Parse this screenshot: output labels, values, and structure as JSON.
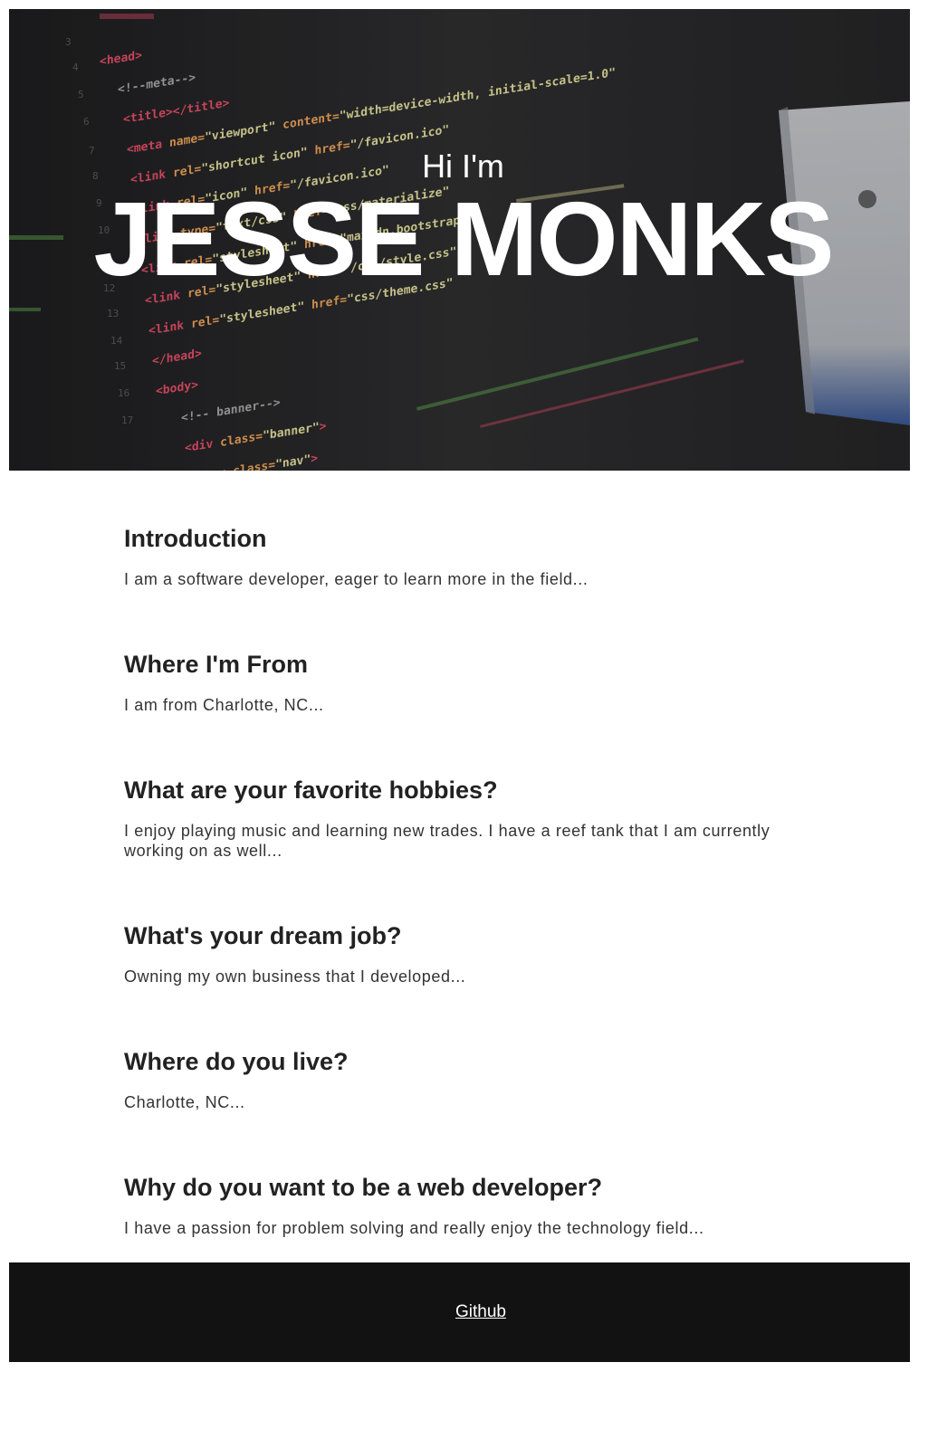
{
  "hero": {
    "greeting": "Hi I'm",
    "name": "JESSE MONKS",
    "background": "code-editor-photo"
  },
  "sections": [
    {
      "heading": "Introduction",
      "body": "I am a software developer, eager to learn more in the field..."
    },
    {
      "heading": "Where I'm From",
      "body": "I am from Charlotte, NC..."
    },
    {
      "heading": "What are your favorite hobbies?",
      "body": "I enjoy playing music and learning new trades. I have a reef tank that I am currently working on as well..."
    },
    {
      "heading": "What's your dream job?",
      "body": "Owning my own business that I developed..."
    },
    {
      "heading": "Where do you live?",
      "body": "Charlotte, NC..."
    },
    {
      "heading": "Why do you want to be a web developer?",
      "body": "I have a passion for problem solving and really enjoy the technology field..."
    }
  ],
  "footer": {
    "link_label": "Github"
  },
  "colors": {
    "hero_bg": "#2d2d2f",
    "footer_bg": "#121212",
    "heading": "#222222",
    "body_text": "#333333"
  }
}
